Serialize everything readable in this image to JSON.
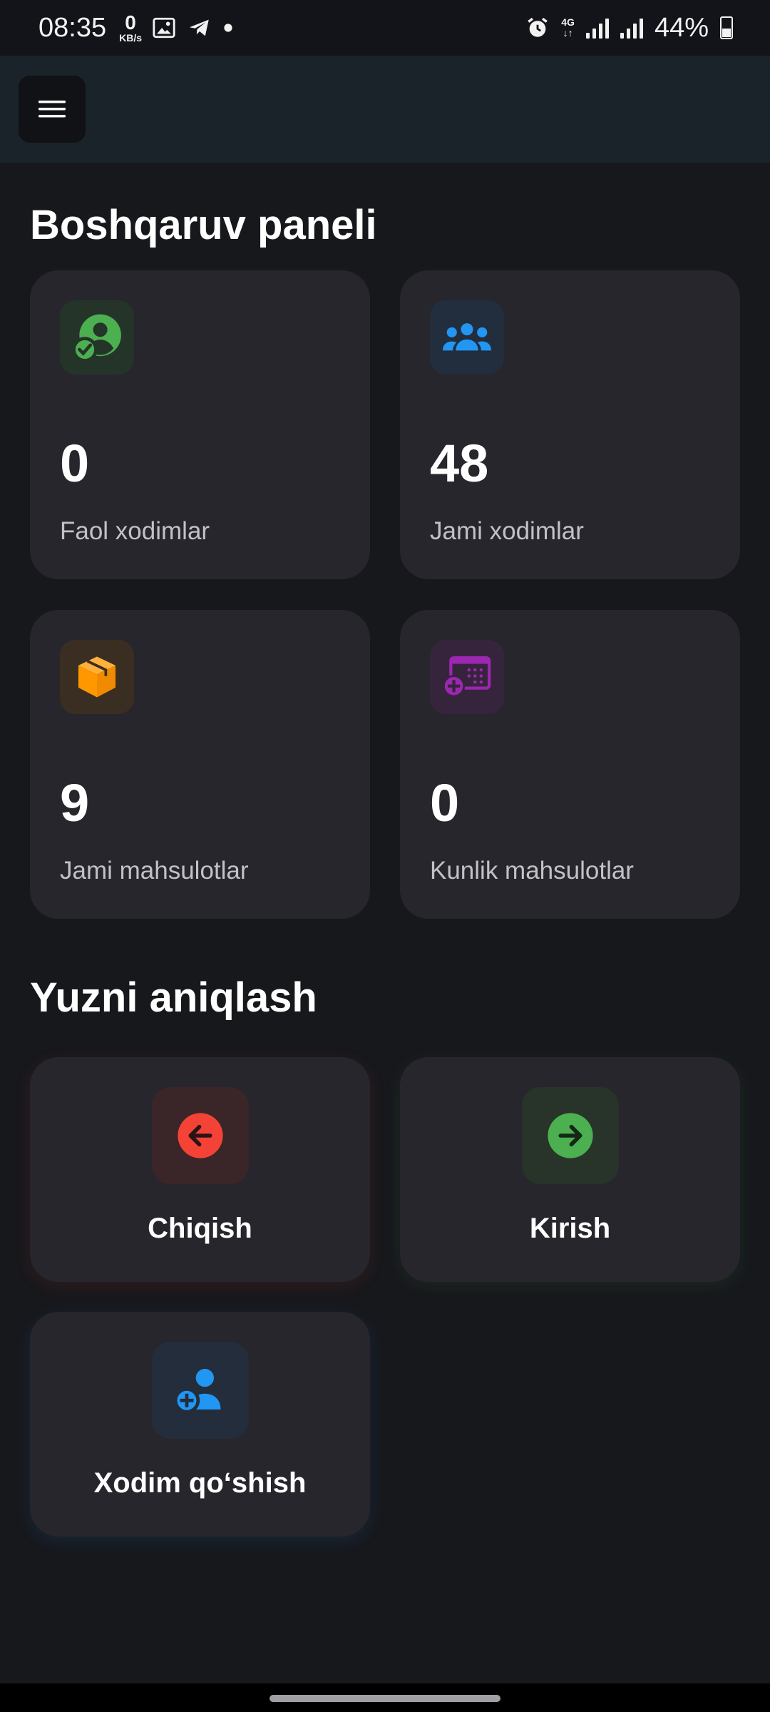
{
  "status_bar": {
    "time": "08:35",
    "speed_value": "0",
    "speed_unit": "KB/s",
    "network": "4G",
    "battery": "44%"
  },
  "dashboard": {
    "title": "Boshqaruv paneli",
    "stats": [
      {
        "value": "0",
        "label": "Faol xodimlar",
        "icon": "user-check-icon",
        "color": "#4caf50"
      },
      {
        "value": "48",
        "label": "Jami xodimlar",
        "icon": "group-icon",
        "color": "#2196f3"
      },
      {
        "value": "9",
        "label": "Jami mahsulotlar",
        "icon": "box-icon",
        "color": "#ff9800"
      },
      {
        "value": "0",
        "label": "Kunlik mahsulotlar",
        "icon": "calendar-add-icon",
        "color": "#9c27b0"
      }
    ]
  },
  "face_recognition": {
    "title": "Yuzni aniqlash",
    "actions": [
      {
        "label": "Chiqish",
        "icon": "arrow-left-circle-icon",
        "color": "#f44336"
      },
      {
        "label": "Kirish",
        "icon": "arrow-right-circle-icon",
        "color": "#4caf50"
      },
      {
        "label": "Xodim qo‘shish",
        "icon": "person-add-icon",
        "color": "#2196f3"
      }
    ]
  }
}
